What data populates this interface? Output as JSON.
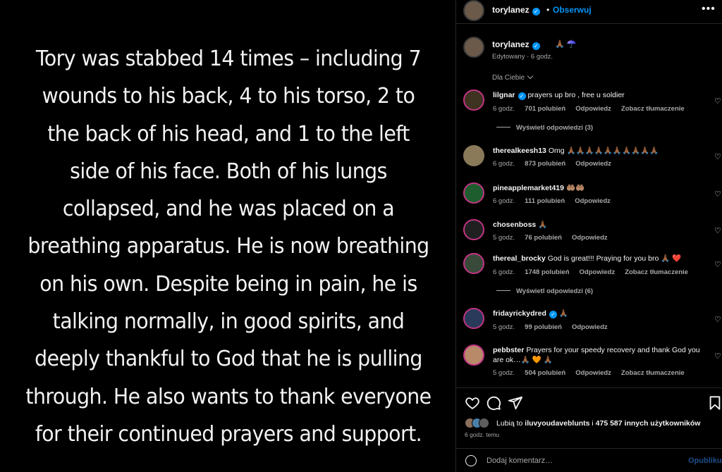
{
  "post": {
    "text": "Tory was stabbed 14 times – including 7 wounds to his back, 4 to his torso, 2 to the back of his head, and 1 to the left side of his face. Both of his lungs collapsed, and he was placed on a breathing apparatus. He is now breathing on his own. Despite being in pain, he is talking normally, in good spirits, and deeply thankful to God that he is pulling through. He also wants to thank everyone for their continued prayers and support."
  },
  "header": {
    "username": "torylanez",
    "separator": "•",
    "follow_label": "Obserwuj",
    "more_icon": "more-options-icon"
  },
  "caption": {
    "username": "torylanez",
    "text": "🙏🏾 ☂️",
    "meta": "Edytowany · 6 godz."
  },
  "sort_label": "Dla Ciebie",
  "comments": [
    {
      "username": "lilgnar",
      "verified": true,
      "text": "prayers up bro , free u soldier",
      "time": "6 godz.",
      "likes": "701 polubień",
      "reply": "Odpowiedz",
      "translate": "Zobacz tłumaczenie",
      "replies": "Wyświetl odpowiedzi (3)"
    },
    {
      "username": "therealkeesh13",
      "verified": false,
      "text": "Omg 🙏🏾🙏🏾🙏🏾🙏🏾🙏🏾🙏🏾🙏🏾🙏🏾🙏🏾🙏🏾",
      "time": "6 godz.",
      "likes": "873 polubień",
      "reply": "Odpowiedz",
      "translate": "",
      "replies": ""
    },
    {
      "username": "pineapplemarket419",
      "verified": false,
      "text": "🤲🏽🤲🏽",
      "time": "6 godz.",
      "likes": "111 polubień",
      "reply": "Odpowiedz",
      "translate": "",
      "replies": ""
    },
    {
      "username": "chosenboss",
      "verified": false,
      "text": "🙏🏾",
      "time": "5 godz.",
      "likes": "76 polubień",
      "reply": "Odpowiedz",
      "translate": "",
      "replies": ""
    },
    {
      "username": "thereal_brocky",
      "verified": false,
      "text": "God is great!!! Praying for you bro 🙏🏾 ❤️",
      "time": "6 godz.",
      "likes": "1748 polubień",
      "reply": "Odpowiedz",
      "translate": "Zobacz tłumaczenie",
      "replies": "Wyświetl odpowiedzi (6)"
    },
    {
      "username": "fridayrickydred",
      "verified": true,
      "text": "🙏🏾",
      "time": "5 godz.",
      "likes": "99 polubień",
      "reply": "Odpowiedz",
      "translate": "",
      "replies": ""
    },
    {
      "username": "pebbster",
      "verified": false,
      "text": "Prayers for your speedy recovery and thank God you are ok…🙏🏾 🧡 🙏🏾",
      "time": "5 godz.",
      "likes": "504 polubień",
      "reply": "Odpowiedz",
      "translate": "Zobacz tłumaczenie",
      "replies": ""
    }
  ],
  "actions": {
    "like_icon": "heart-icon",
    "comment_icon": "comment-icon",
    "share_icon": "share-icon",
    "save_icon": "bookmark-icon"
  },
  "likes": {
    "prefix": "Lubią to ",
    "user": "iluvyoudaveblunts",
    "middle": " i ",
    "count": "475 587 innych użytkowników"
  },
  "posted": "6 godz. temu",
  "comment_box": {
    "placeholder": "Dodaj komentarz…",
    "publish_label": "Opublikuj"
  },
  "colors": {
    "accent": "#0095f6",
    "background": "#000000",
    "secondary_text": "#a8a8a8",
    "divider": "#262626"
  }
}
